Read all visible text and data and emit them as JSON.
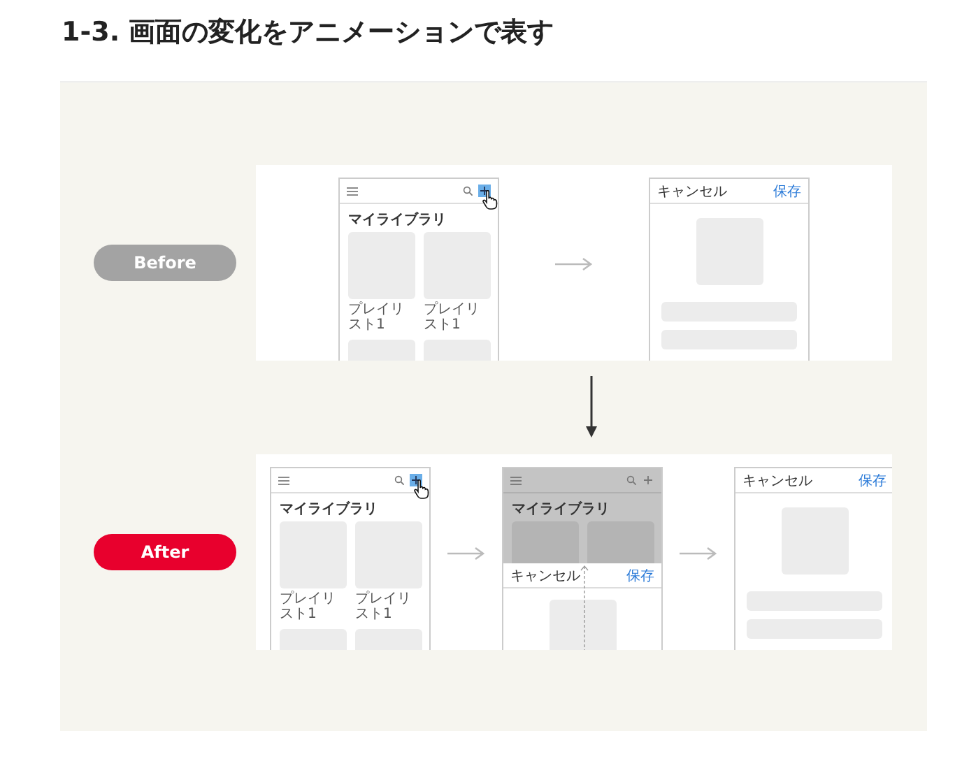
{
  "heading": "1-3. 画面の変化をアニメーションで表す",
  "steps": [
    {
      "label": "Before",
      "color": "#a3a3a3",
      "screens": [
        {
          "kind": "library",
          "title": "マイライブラリ",
          "add_highlighted": true,
          "items": [
            "プレイリスト1",
            "プレイリスト1"
          ]
        },
        {
          "kind": "editor",
          "cancel": "キャンセル",
          "save": "保存"
        }
      ]
    },
    {
      "label": "After",
      "color": "#e8002d",
      "screens": [
        {
          "kind": "library",
          "title": "マイライブラリ",
          "add_highlighted": true,
          "items": [
            "プレイリスト1",
            "プレイリスト1"
          ]
        },
        {
          "kind": "transition",
          "title": "マイライブラリ",
          "add_highlighted": false,
          "cancel": "キャンセル",
          "save": "保存"
        },
        {
          "kind": "editor",
          "cancel": "キャンセル",
          "save": "保存"
        }
      ]
    }
  ]
}
